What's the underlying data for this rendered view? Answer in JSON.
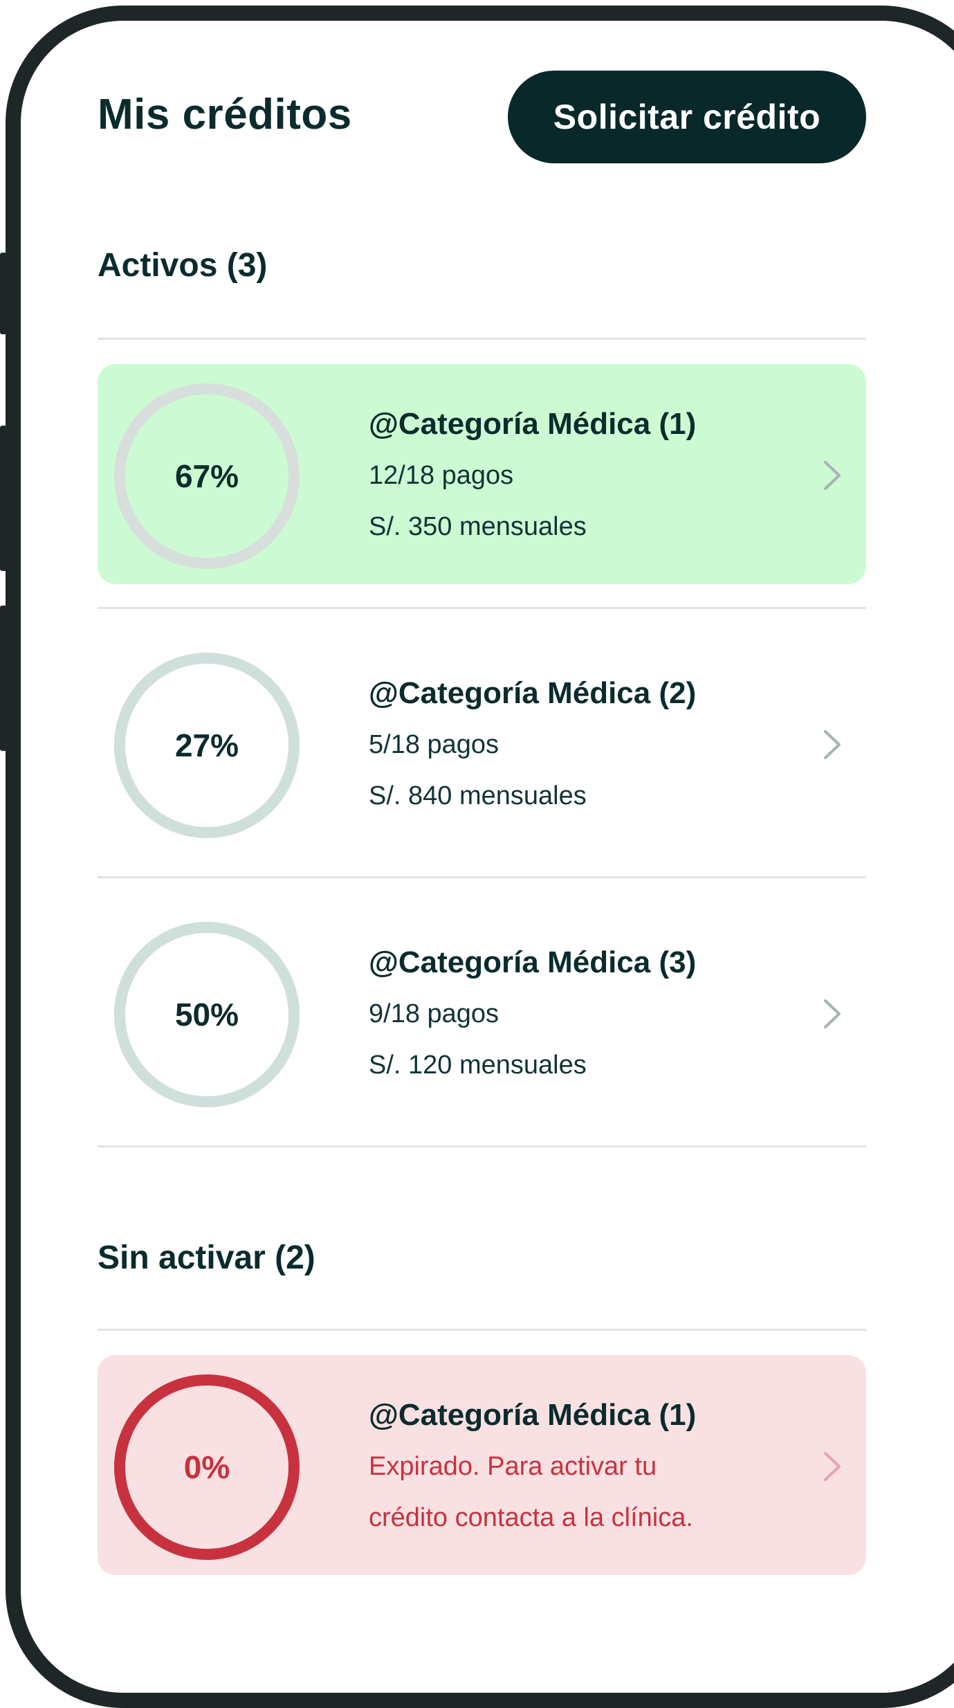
{
  "header": {
    "title": "Mis créditos",
    "cta_label": "Solicitar crédito"
  },
  "sections": {
    "active": {
      "title": "Activos (3)",
      "items": [
        {
          "name": "@Categoría Médica (1)",
          "progress_label": "67%",
          "progress": 0.67,
          "payments": "12/18 pagos",
          "monthly": "S/. 350 mensuales",
          "highlighted": true
        },
        {
          "name": "@Categoría Médica (2)",
          "progress_label": "27%",
          "progress": 0.27,
          "payments": "5/18 pagos",
          "monthly": "S/. 840 mensuales",
          "highlighted": false
        },
        {
          "name": "@Categoría Médica (3)",
          "progress_label": "50%",
          "progress": 0.5,
          "payments": "9/18 pagos",
          "monthly": "S/. 120 mensuales",
          "highlighted": false
        }
      ]
    },
    "inactive": {
      "title": "Sin activar (2)",
      "items": [
        {
          "name": "@Categoría Médica (1)",
          "progress_label": "0%",
          "progress": 0,
          "message_line1": "Expirado. Para activar tu",
          "message_line2": "crédito contacta a la clínica."
        }
      ]
    }
  },
  "colors": {
    "progress_green": "#3a9a5c",
    "track_light": "#cfdfdc",
    "track_on_green": "#d8dedc",
    "expired_red": "#c8323e",
    "dark_text": "#0b2b2c",
    "card_green_bg": "#ccfbd3",
    "card_red_bg": "#f9e1e3"
  },
  "icons": {
    "row_action": "chevron-right-icon"
  }
}
